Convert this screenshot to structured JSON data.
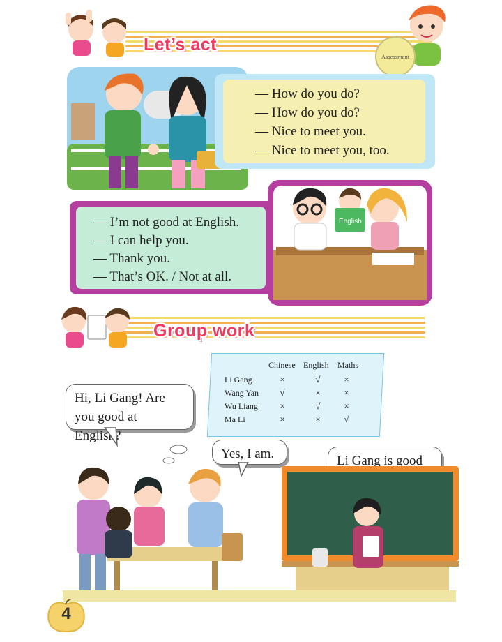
{
  "section1": {
    "title": "Let’s act",
    "assessment_label": "Assessment"
  },
  "dialogue1": {
    "lines": [
      "— How do you do?",
      "— How do you do?",
      "— Nice to meet you.",
      "— Nice to meet you, too."
    ]
  },
  "dialogue2": {
    "lines": [
      "— I’m not good at English.",
      "— I can help you.",
      "— Thank you.",
      "— That’s OK. / Not at all."
    ],
    "book_label": "English"
  },
  "section2": {
    "title": "Group work"
  },
  "table": {
    "headers": [
      "Chinese",
      "English",
      "Maths"
    ],
    "rows": [
      {
        "name": "Li Gang",
        "marks": [
          "×",
          "√",
          "×"
        ]
      },
      {
        "name": "Wang Yan",
        "marks": [
          "√",
          "×",
          "×"
        ]
      },
      {
        "name": "Wu Liang",
        "marks": [
          "×",
          "√",
          "×"
        ]
      },
      {
        "name": "Ma Li",
        "marks": [
          "×",
          "×",
          "√"
        ]
      }
    ]
  },
  "bubbles": {
    "question": "Hi, Li Gang! Are you good at English?",
    "answer": "Yes, I am.",
    "report": "Li Gang is good at English."
  },
  "page": {
    "number": "4"
  },
  "colors": {
    "title": "#ee3a5f",
    "stripe_orange": "#f3b04e",
    "stripe_yellow": "#f5d96a",
    "box1_border": "#bfe7f6",
    "box1_fill": "#f6efb2",
    "box2_border": "#b43f9e",
    "box2_fill": "#c4ecd7",
    "chalkboard": "#2f5e4a"
  }
}
